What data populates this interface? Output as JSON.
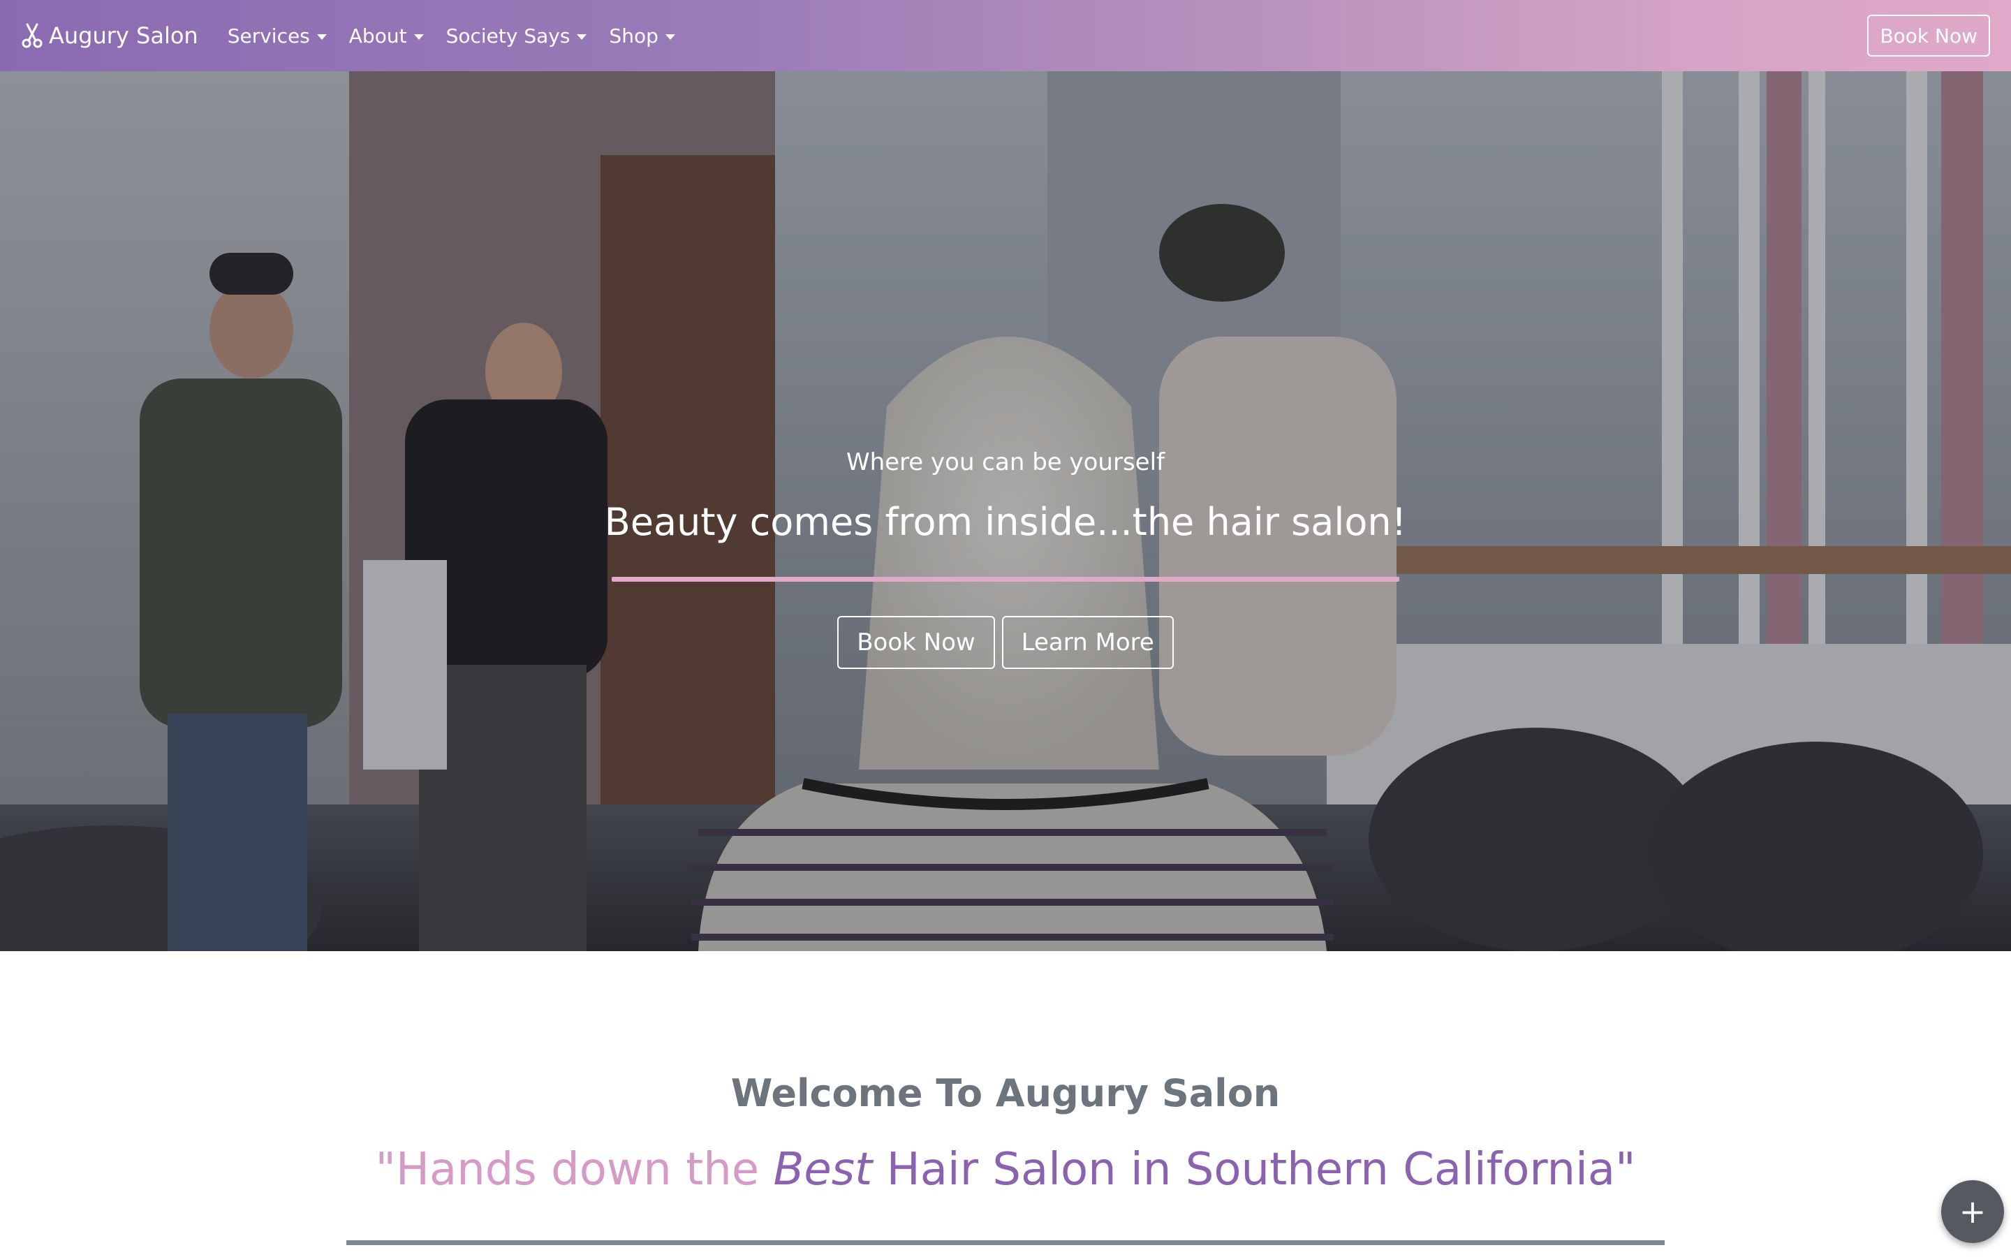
{
  "navbar": {
    "brand": "Augury Salon",
    "brand_icon": "scissors-icon",
    "items": [
      {
        "label": "Services"
      },
      {
        "label": "About"
      },
      {
        "label": "Society Says"
      },
      {
        "label": "Shop"
      }
    ],
    "book_label": "Book Now"
  },
  "hero": {
    "subtitle": "Where you can be yourself",
    "title": "Beauty comes from inside...the hair salon!",
    "book_label": "Book Now",
    "learn_label": "Learn More"
  },
  "welcome": {
    "title": "Welcome To Augury Salon",
    "quote_open": "\"Hands down the ",
    "quote_best": "Best",
    "quote_rest": " Hair Salon in Southern California\""
  },
  "fab": {
    "icon": "plus-icon",
    "label": "+"
  },
  "colors": {
    "nav_gradient_start": "#8a6bb2",
    "nav_gradient_end": "#e0a9c9",
    "accent_pink": "#e0a9c9",
    "quote_purple": "#8a62b0",
    "heading_gray": "#6c757d"
  }
}
